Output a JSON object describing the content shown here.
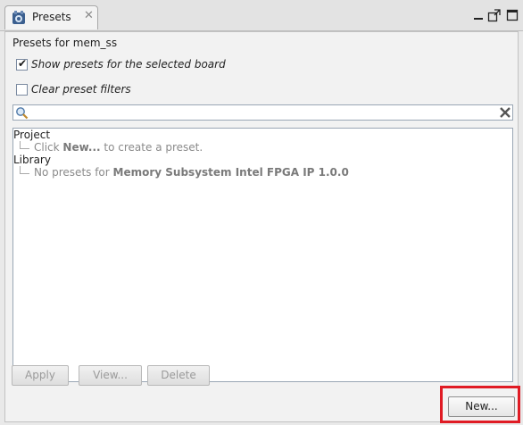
{
  "tab": {
    "label": "Presets"
  },
  "panel": {
    "title": "Presets for mem_ss",
    "show_presets_label": "Show presets for the selected board",
    "show_presets_checked": true,
    "clear_filters_label": "Clear preset filters",
    "clear_filters_checked": false,
    "search_value": ""
  },
  "tree": {
    "project_label": "Project",
    "project_leaf_pre": "Click ",
    "project_leaf_bold": "New...",
    "project_leaf_post": " to create a preset.",
    "library_label": "Library",
    "library_leaf_pre": "No presets for ",
    "library_leaf_bold": "Memory Subsystem Intel FPGA IP 1.0.0"
  },
  "buttons": {
    "apply": "Apply",
    "view": "View...",
    "delete": "Delete",
    "new": "New..."
  }
}
